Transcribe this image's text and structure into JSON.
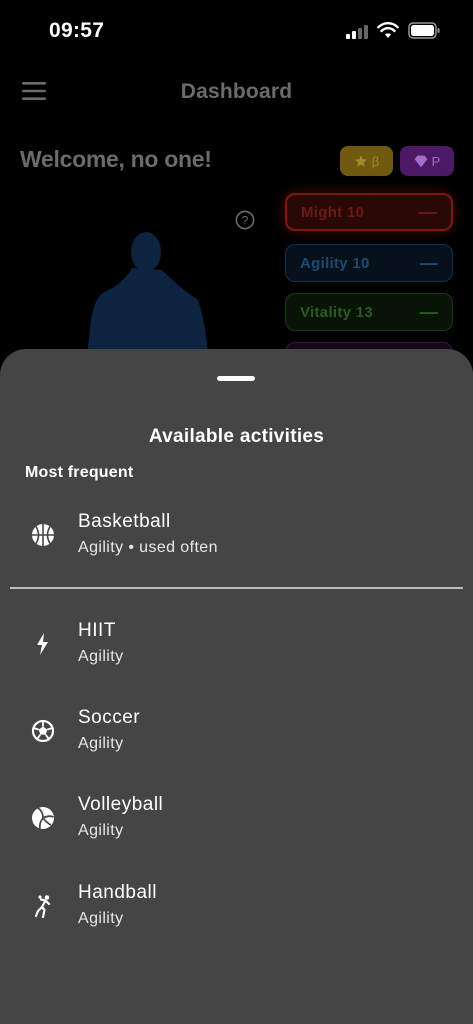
{
  "status_bar": {
    "time": "09:57",
    "icons": [
      "cellular-icon",
      "wifi-icon",
      "battery-icon"
    ]
  },
  "app_bar": {
    "title": "Dashboard",
    "menu_icon": "hamburger-icon"
  },
  "dashboard": {
    "welcome": "Welcome, no one!",
    "badges": [
      {
        "icon": "star-icon",
        "label": "β",
        "color": "#6f5a10"
      },
      {
        "icon": "diamond-icon",
        "label": "P",
        "color": "#4b1966"
      }
    ],
    "help_icon": "help-circle-icon",
    "stats": [
      {
        "label": "Might 10",
        "action": "—",
        "color": "#e53935"
      },
      {
        "label": "Agility 10",
        "action": "—",
        "color": "#1e88e5"
      },
      {
        "label": "Vitality 13",
        "action": "—",
        "color": "#43a047"
      }
    ]
  },
  "sheet": {
    "title": "Available activities",
    "section_label": "Most frequent",
    "frequent": [
      {
        "name": "Basketball",
        "sub": "Agility • used often",
        "icon": "basketball-icon"
      }
    ],
    "activities": [
      {
        "name": "HIIT",
        "sub": "Agility",
        "icon": "bolt-icon"
      },
      {
        "name": "Soccer",
        "sub": "Agility",
        "icon": "soccer-ball-icon"
      },
      {
        "name": "Volleyball",
        "sub": "Agility",
        "icon": "volleyball-icon"
      },
      {
        "name": "Handball",
        "sub": "Agility",
        "icon": "handball-icon"
      }
    ]
  }
}
